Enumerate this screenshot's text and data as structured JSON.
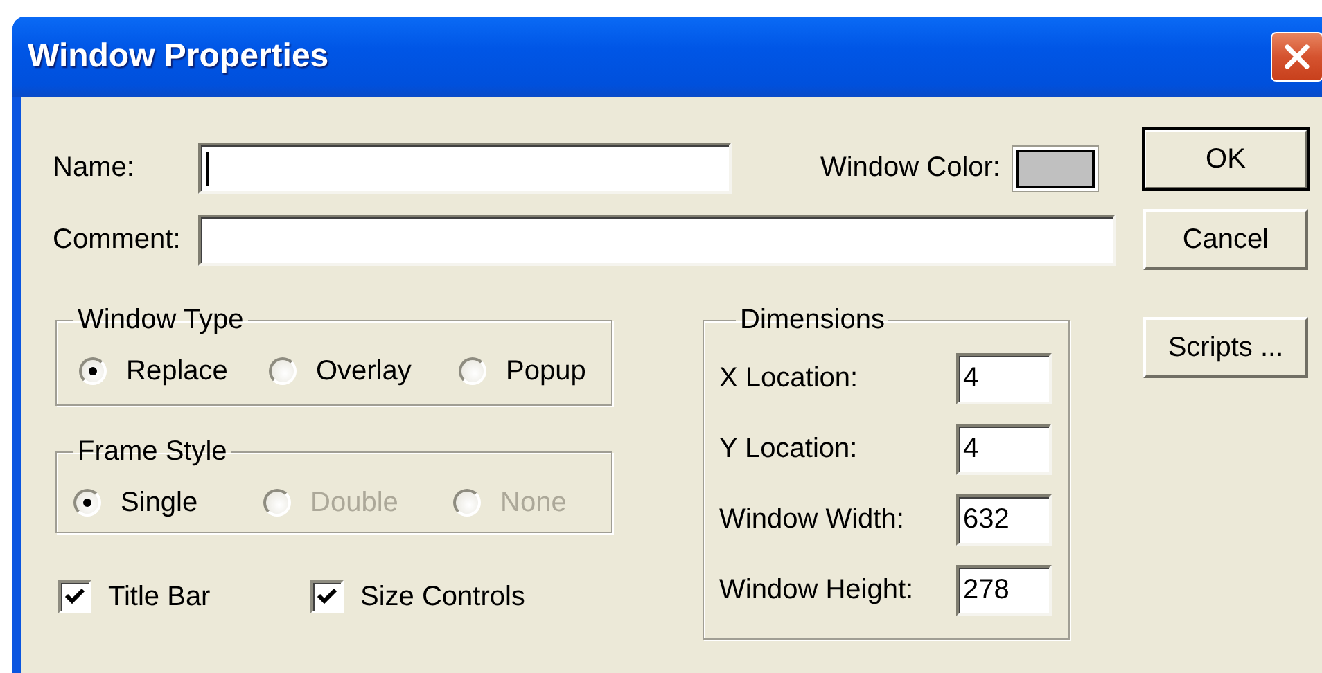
{
  "window": {
    "title": "Window Properties"
  },
  "fields": [
    {
      "label": "Name:",
      "focused": true
    },
    {
      "label": "Comment:",
      "focused": false
    }
  ],
  "window_color": {
    "label": "Window Color:",
    "color": "#c0c0c0"
  },
  "buttons": [
    {
      "label": "OK",
      "default": true
    },
    {
      "label": "Cancel",
      "default": false
    },
    {
      "label": "Scripts ...",
      "default": false
    }
  ],
  "window_type": {
    "legend": "Window Type",
    "options": [
      {
        "label": "Replace",
        "selected": true,
        "disabled": false
      },
      {
        "label": "Overlay",
        "selected": false,
        "disabled": false
      },
      {
        "label": "Popup",
        "selected": false,
        "disabled": false
      }
    ]
  },
  "frame_style": {
    "legend": "Frame Style",
    "options": [
      {
        "label": "Single",
        "selected": true,
        "disabled": false
      },
      {
        "label": "Double",
        "selected": false,
        "disabled": true
      },
      {
        "label": "None",
        "selected": false,
        "disabled": true
      }
    ]
  },
  "checkboxes": [
    {
      "label": "Title Bar",
      "checked": true
    },
    {
      "label": "Size Controls",
      "checked": true
    }
  ],
  "dimensions": {
    "legend": "Dimensions",
    "rows": [
      {
        "label": "X Location:",
        "value": "4"
      },
      {
        "label": "Y Location:",
        "value": "4"
      },
      {
        "label": "Window Width:",
        "value": "632"
      },
      {
        "label": "Window Height:",
        "value": "278"
      }
    ]
  }
}
